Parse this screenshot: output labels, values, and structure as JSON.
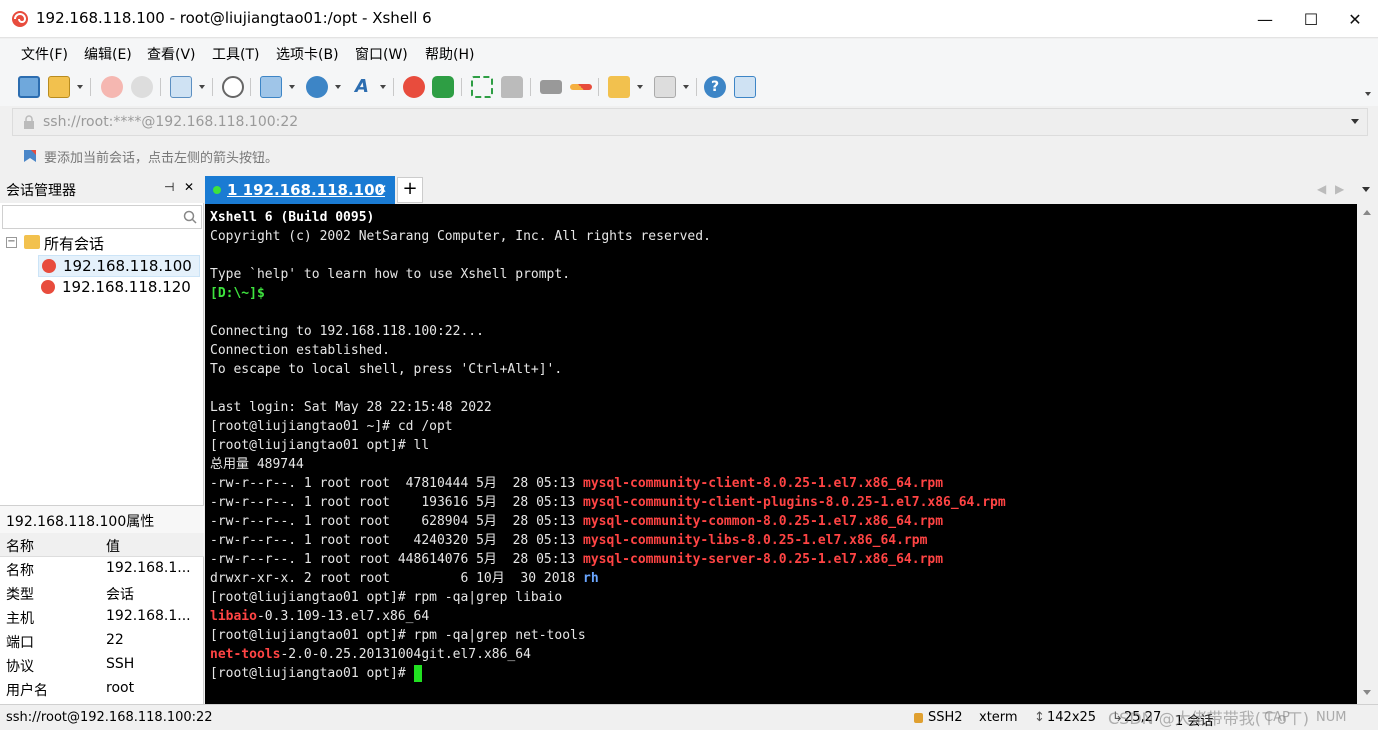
{
  "window": {
    "title": "192.168.118.100 - root@liujiangtao01:/opt - Xshell 6",
    "minimize": "—",
    "maximize": "☐",
    "close": "✕"
  },
  "menu": [
    "文件(F)",
    "编辑(E)",
    "查看(V)",
    "工具(T)",
    "选项卡(B)",
    "窗口(W)",
    "帮助(H)"
  ],
  "address": {
    "value": "ssh://root:****@192.168.118.100:22"
  },
  "hint": "要添加当前会话，点击左侧的箭头按钮。",
  "session_manager": {
    "title": "会话管理器",
    "pin": "⊣",
    "close": "✕",
    "root_folder": "所有会话",
    "sessions": [
      "192.168.118.100",
      "192.168.118.120"
    ]
  },
  "properties": {
    "title": "192.168.118.100属性",
    "headers": [
      "名称",
      "值"
    ],
    "rows": [
      {
        "name": "名称",
        "value": "192.168.1..."
      },
      {
        "name": "类型",
        "value": "会话"
      },
      {
        "name": "主机",
        "value": "192.168.1..."
      },
      {
        "name": "端口",
        "value": "22"
      },
      {
        "name": "协议",
        "value": "SSH"
      },
      {
        "name": "用户名",
        "value": "root"
      }
    ]
  },
  "tabs": [
    {
      "label": "1 192.168.118.100",
      "close": "✕"
    }
  ],
  "new_tab": "+",
  "terminal": {
    "banner": "Xshell 6 (Build 0095)",
    "copyright": "Copyright (c) 2002 NetSarang Computer, Inc. All rights reserved.",
    "help": "Type `help' to learn how to use Xshell prompt.",
    "local_prompt": "[D:\\~]$",
    "connecting": "Connecting to 192.168.118.100:22...",
    "established": "Connection established.",
    "escape": "To escape to local shell, press 'Ctrl+Alt+]'.",
    "last_login": "Last login: Sat May 28 22:15:48 2022",
    "cmd1": "[root@liujiangtao01 ~]# cd /opt",
    "cmd2": "[root@liujiangtao01 opt]# ll",
    "total": "总用量 489744",
    "files": [
      {
        "meta": "-rw-r--r--. 1 root root  47810444 5月  28 05:13 ",
        "name": "mysql-community-client-8.0.25-1.el7.x86_64.rpm"
      },
      {
        "meta": "-rw-r--r--. 1 root root    193616 5月  28 05:13 ",
        "name": "mysql-community-client-plugins-8.0.25-1.el7.x86_64.rpm"
      },
      {
        "meta": "-rw-r--r--. 1 root root    628904 5月  28 05:13 ",
        "name": "mysql-community-common-8.0.25-1.el7.x86_64.rpm"
      },
      {
        "meta": "-rw-r--r--. 1 root root   4240320 5月  28 05:13 ",
        "name": "mysql-community-libs-8.0.25-1.el7.x86_64.rpm"
      },
      {
        "meta": "-rw-r--r--. 1 root root 448614076 5月  28 05:13 ",
        "name": "mysql-community-server-8.0.25-1.el7.x86_64.rpm"
      }
    ],
    "dir_meta": "drwxr-xr-x. 2 root root         6 10月  30 2018 ",
    "dir_name": "rh",
    "cmd3": "[root@liujiangtao01 opt]# rpm -qa|grep libaio",
    "res3_hl": "libaio",
    "res3_rest": "-0.3.109-13.el7.x86_64",
    "cmd4": "[root@liujiangtao01 opt]# rpm -qa|grep net-tools",
    "res4_hl": "net-tools",
    "res4_rest": "-2.0-0.25.20131004git.el7.x86_64",
    "prompt": "[root@liujiangtao01 opt]# "
  },
  "status": {
    "path": "ssh://root@192.168.118.100:22",
    "protocol": "SSH2",
    "term": "xterm",
    "size": "142x25",
    "pos": "25,27",
    "sessions": "1 会话",
    "watermark": "CSDN @大佬带带我(ㄒoㄒ)",
    "cap": "CAP",
    "num": "NUM"
  },
  "colors": {
    "tab_active": "#1a7bd3",
    "terminal_bg": "#000000",
    "highlight_red": "#ff4444",
    "prompt_green": "#3ee33e"
  }
}
